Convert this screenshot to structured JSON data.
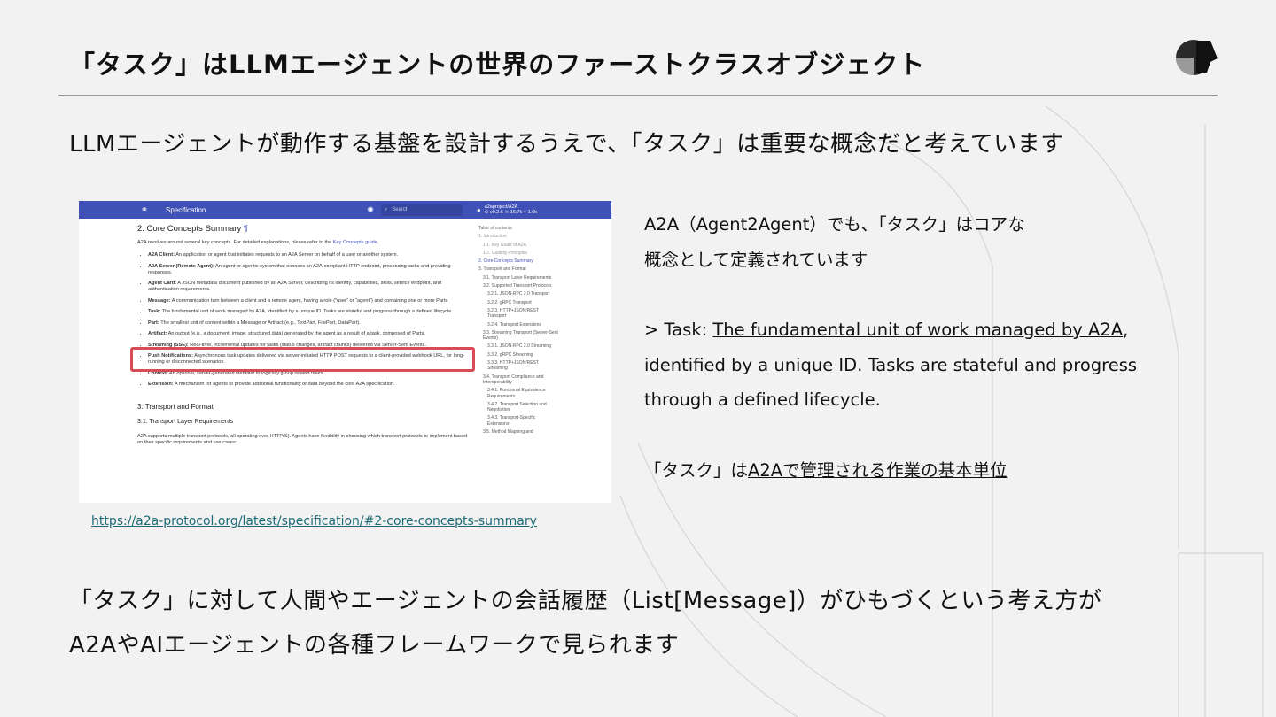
{
  "slide": {
    "title": "「タスク」はLLMエージェントの世界のファーストクラスオブジェクト",
    "lead": "LLMエージェントが動作する基盤を設計するうえで、「タスク」は重要な概念だと考えています",
    "source_url": "https://a2a-protocol.org/latest/specification/#2-core-concepts-summary",
    "bottom_line1": "「タスク」に対して人間やエージェントの会話履歴（List[Message]）がひもづくという考え方が",
    "bottom_line2": "A2AやAIエージェントの各種フレームワークで見られます"
  },
  "right": {
    "line1": "A2A（Agent2Agent）でも、「タスク」はコアな",
    "line2": "概念として定義されています",
    "quote_prefix": "> Task: ",
    "quote_link": "The fundamental unit of work managed by A2A",
    "quote_rest1": ",",
    "quote_line2": "identified by a unique ID. Tasks are stateful and progress",
    "quote_line3": "through a defined lifecycle.",
    "jp_prefix": "「タスク」は",
    "jp_link": "A2Aで管理される作業の基本単位"
  },
  "screenshot": {
    "nav_title": "Specification",
    "search_placeholder": "Search",
    "repo_name": "a2aproject/A2A",
    "repo_stats": "⊙ v0.2.6 ☆ 16.7k ⑂ 1.6k",
    "h2": "2. Core Concepts Summary",
    "pilcrow": "¶",
    "intro": "A2A revolves around several key concepts. For detailed explanations, please refer to the ",
    "intro_link": "Key Concepts guide",
    "intro_end": ".",
    "items": [
      {
        "term": "A2A Client:",
        "text": " An application or agent that initiates requests to an A2A Server on behalf of a user or another system."
      },
      {
        "term": "A2A Server (Remote Agent):",
        "text": " An agent or agentic system that exposes an A2A-compliant HTTP endpoint, processing tasks and providing responses."
      },
      {
        "term": "Agent Card:",
        "text": " A JSON metadata document published by an A2A Server, describing its identity, capabilities, skills, service endpoint, and authentication requirements."
      },
      {
        "term": "Message:",
        "text": " A communication turn between a client and a remote agent, having a role (\"user\" or \"agent\") and containing one or more Parts."
      },
      {
        "term": "Task:",
        "text": " The fundamental unit of work managed by A2A, identified by a unique ID. Tasks are stateful and progress through a defined lifecycle."
      },
      {
        "term": "Part:",
        "text": " The smallest unit of content within a Message or Artifact (e.g., TextPart, FilePart, DataPart)."
      },
      {
        "term": "Artifact:",
        "text": " An output (e.g., a document, image, structured data) generated by the agent as a result of a task, composed of Parts."
      },
      {
        "term": "Streaming (SSE):",
        "text": " Real-time, incremental updates for tasks (status changes, artifact chunks) delivered via Server-Sent Events."
      },
      {
        "term": "Push Notifications:",
        "text": " Asynchronous task updates delivered via server-initiated HTTP POST requests to a client-provided webhook URL, for long-running or disconnected scenarios."
      },
      {
        "term": "Context:",
        "text": " An optional, server-generated identifier to logically group related tasks."
      },
      {
        "term": "Extension:",
        "text": " A mechanism for agents to provide additional functionality or data beyond the core A2A specification."
      }
    ],
    "h3": "3. Transport and Format",
    "h4": "3.1. Transport Layer Requirements",
    "para": "A2A supports multiple transport protocols, all operating over HTTP(S). Agents have flexibility in choosing which transport protocols to implement based on their specific requirements and use cases:",
    "toc_title": "Table of contents",
    "toc": [
      {
        "label": "1. Introduction",
        "level": "l1",
        "cls": "gray"
      },
      {
        "label": "1.1. Key Goals of A2A",
        "level": "l2",
        "cls": "gray"
      },
      {
        "label": "1.2. Guiding Principles",
        "level": "l2",
        "cls": "gray"
      },
      {
        "label": "2. Core Concepts Summary",
        "level": "l1",
        "cls": "active"
      },
      {
        "label": "3. Transport and Format",
        "level": "l1",
        "cls": ""
      },
      {
        "label": "3.1. Transport Layer Requirements",
        "level": "l2",
        "cls": ""
      },
      {
        "label": "3.2. Supported Transport Protocols",
        "level": "l2",
        "cls": ""
      },
      {
        "label": "3.2.1. JSON-RPC 2.0 Transport",
        "level": "l3",
        "cls": ""
      },
      {
        "label": "3.2.2. gRPC Transport",
        "level": "l3",
        "cls": ""
      },
      {
        "label": "3.2.3. HTTP+JSON/REST Transport",
        "level": "l3",
        "cls": ""
      },
      {
        "label": "3.2.4. Transport Extensions",
        "level": "l3",
        "cls": ""
      },
      {
        "label": "3.3. Streaming Transport (Server-Sent Events)",
        "level": "l2",
        "cls": ""
      },
      {
        "label": "3.3.1. JSON-RPC 2.0 Streaming",
        "level": "l3",
        "cls": ""
      },
      {
        "label": "3.3.2. gRPC Streaming",
        "level": "l3",
        "cls": ""
      },
      {
        "label": "3.3.3. HTTP+JSON/REST Streaming",
        "level": "l3",
        "cls": ""
      },
      {
        "label": "3.4. Transport Compliance and Interoperability",
        "level": "l2",
        "cls": ""
      },
      {
        "label": "3.4.1. Functional Equivalence Requirements",
        "level": "l3",
        "cls": ""
      },
      {
        "label": "3.4.2. Transport Selection and Negotiation",
        "level": "l3",
        "cls": ""
      },
      {
        "label": "3.4.3. Transport-Specific Extensions",
        "level": "l3",
        "cls": ""
      },
      {
        "label": "3.5. Method Mapping and",
        "level": "l2",
        "cls": ""
      }
    ]
  },
  "colors": {
    "background": "#f2f2f2",
    "nav_blue": "#3f51b5",
    "highlight_red": "#d84c56",
    "link_teal": "#1a6b77"
  }
}
